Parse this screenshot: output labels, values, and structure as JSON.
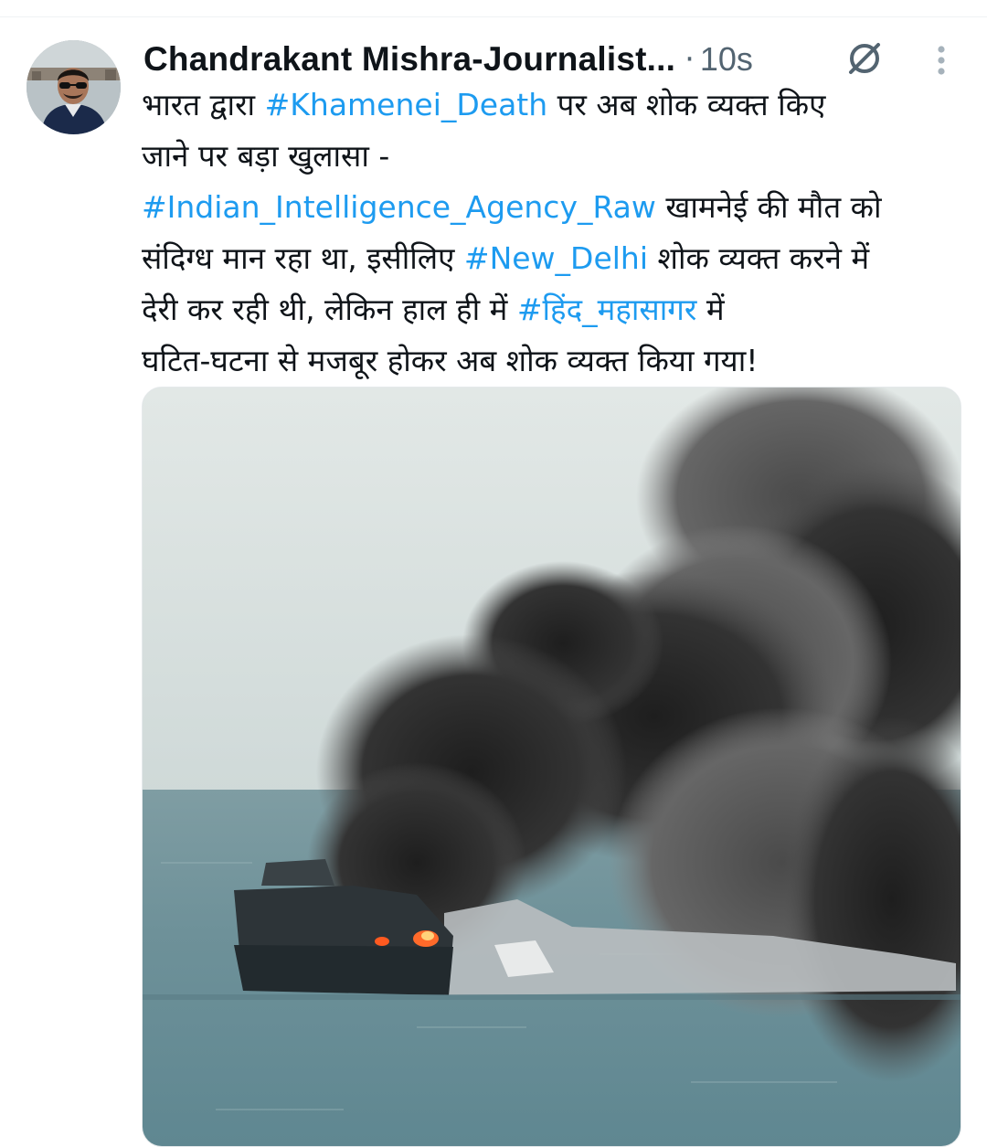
{
  "tweet": {
    "author_name": "Chandrakant Mishra-Journalist...",
    "separator": "·",
    "timestamp": "10s",
    "avatar_icon": "profile-photo",
    "grok_icon": "grok-icon",
    "more_icon": "more-options-icon",
    "text_lines": [
      [
        {
          "text": "भारत द्वारा ",
          "type": "text"
        },
        {
          "text": "#Khamenei_Death",
          "type": "hashtag"
        },
        {
          "text": " पर अब शोक व्यक्त किए",
          "type": "text"
        }
      ],
      [
        {
          "text": "जाने पर बड़ा खुलासा -",
          "type": "text"
        }
      ],
      [
        {
          "text": "#Indian_Intelligence_Agency_Raw",
          "type": "hashtag"
        },
        {
          "text": " खामनेई की मौत को",
          "type": "text"
        }
      ],
      [
        {
          "text": "संदिग्ध मान रहा था, इसीलिए ",
          "type": "text"
        },
        {
          "text": "#New_Delhi",
          "type": "hashtag"
        },
        {
          "text": " शोक व्यक्त करने में",
          "type": "text"
        }
      ],
      [
        {
          "text": "देरी कर रही थी, लेकिन हाल ही में ",
          "type": "text"
        },
        {
          "text": "#हिंद_महासागर",
          "type": "hashtag"
        },
        {
          "text": " में",
          "type": "text"
        }
      ],
      [
        {
          "text": "घटित-घटना से मजबूर होकर अब शोक व्यक्त किया गया!",
          "type": "text"
        }
      ]
    ],
    "media": {
      "kind": "photo",
      "subject": "burning-ship-at-sea"
    }
  },
  "colors": {
    "text": "#0f1419",
    "secondary": "#536471",
    "link": "#1d9bf0",
    "background": "#ffffff"
  }
}
